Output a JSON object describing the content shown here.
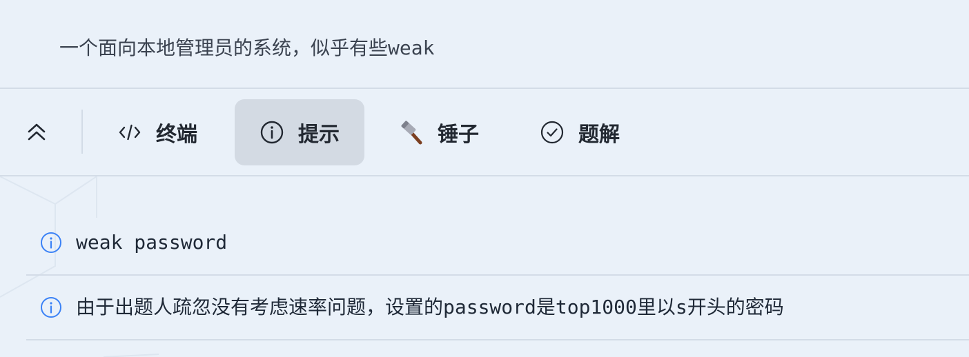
{
  "challenge": {
    "description": "一个面向本地管理员的系统，似乎有些weak"
  },
  "tabs": [
    {
      "id": "terminal",
      "label": "终端",
      "icon": "code-icon",
      "active": false
    },
    {
      "id": "hint",
      "label": "提示",
      "icon": "info-circle-icon",
      "active": true
    },
    {
      "id": "hammer",
      "label": "锤子",
      "icon": "hammer-icon",
      "active": false
    },
    {
      "id": "solution",
      "label": "题解",
      "icon": "check-circle-icon",
      "active": false
    }
  ],
  "collapse": {
    "icon": "chevrons-up-icon"
  },
  "hints": [
    {
      "text": "weak password",
      "icon": "info-circle-icon"
    },
    {
      "text": "由于出题人疏忽没有考虑速率问题，设置的password是top1000里以s开头的密码",
      "icon": "info-circle-icon"
    }
  ],
  "colors": {
    "background": "#eaf1f9",
    "divider": "#d3dce7",
    "active_tab": "#d3dae3",
    "hint_icon": "#3b82f6",
    "text": "#1f2937"
  }
}
